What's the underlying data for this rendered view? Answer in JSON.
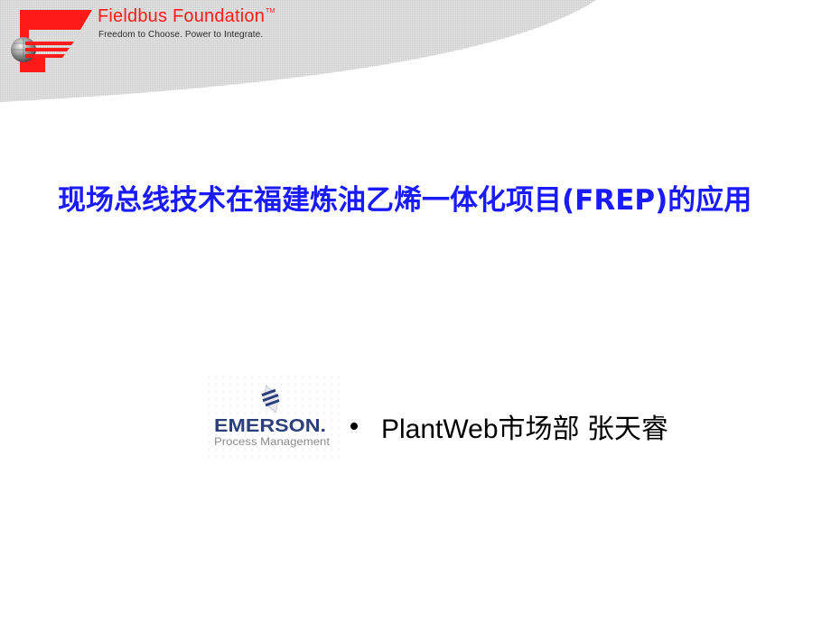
{
  "header": {
    "organization": "Fieldbus Foundation",
    "trademark": "TM",
    "tagline": "Freedom to Choose. Power to Integrate.",
    "logo_icon": "fieldbus-f-globe-logo",
    "brand_color": "#ff1a1a",
    "band_color": "#d9d9d9"
  },
  "slide": {
    "title": "现场总线技术在福建炼油乙烯一体化项目(FREP)的应用",
    "title_color": "#1a1aff"
  },
  "presenter": {
    "logo": {
      "icon": "emerson-logo",
      "company": "EMERSON",
      "division": "Process Management",
      "color": "#2b3f7a"
    },
    "bullet": "•",
    "text": "PlantWeb市场部 张天睿"
  }
}
